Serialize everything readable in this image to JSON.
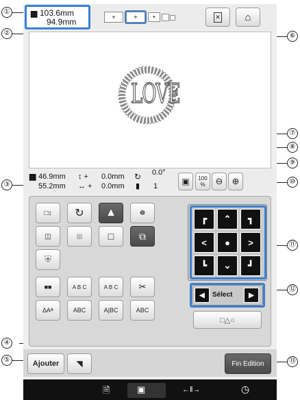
{
  "size": {
    "width_line1": "103.6mm",
    "height_line2": "94.9mm"
  },
  "frame_labels": [
    "+",
    "+",
    "+"
  ],
  "design_text": "LOVE",
  "info": {
    "width": "46.9mm",
    "height": "55.2mm",
    "vert_offset": "0.0mm",
    "horiz_offset": "0.0mm",
    "vert_arrows": "↕ +",
    "horiz_arrows": "↔ +",
    "angle": "0.0°",
    "colors": "1"
  },
  "zoom": {
    "label": "100",
    "unit": "%"
  },
  "font_buttons": {
    "arc": "A B C",
    "arc_down": "A B C",
    "text_space": "A B C",
    "aa": "∆Aᴬ",
    "abc1": "ABC",
    "abc2": "A|BC",
    "abc3": "ABC"
  },
  "select_label": "Sélect",
  "buttons": {
    "add": "Ajouter",
    "end_edit": "Fin Edition"
  },
  "bottom_bar": {
    "arrow_icon": "←‖→"
  },
  "callouts": [
    "①",
    "②",
    "③",
    "④",
    "⑤",
    "⑥",
    "⑦",
    "⑧",
    "⑨",
    "⑩",
    "⑪",
    "⑫",
    "⑬"
  ]
}
